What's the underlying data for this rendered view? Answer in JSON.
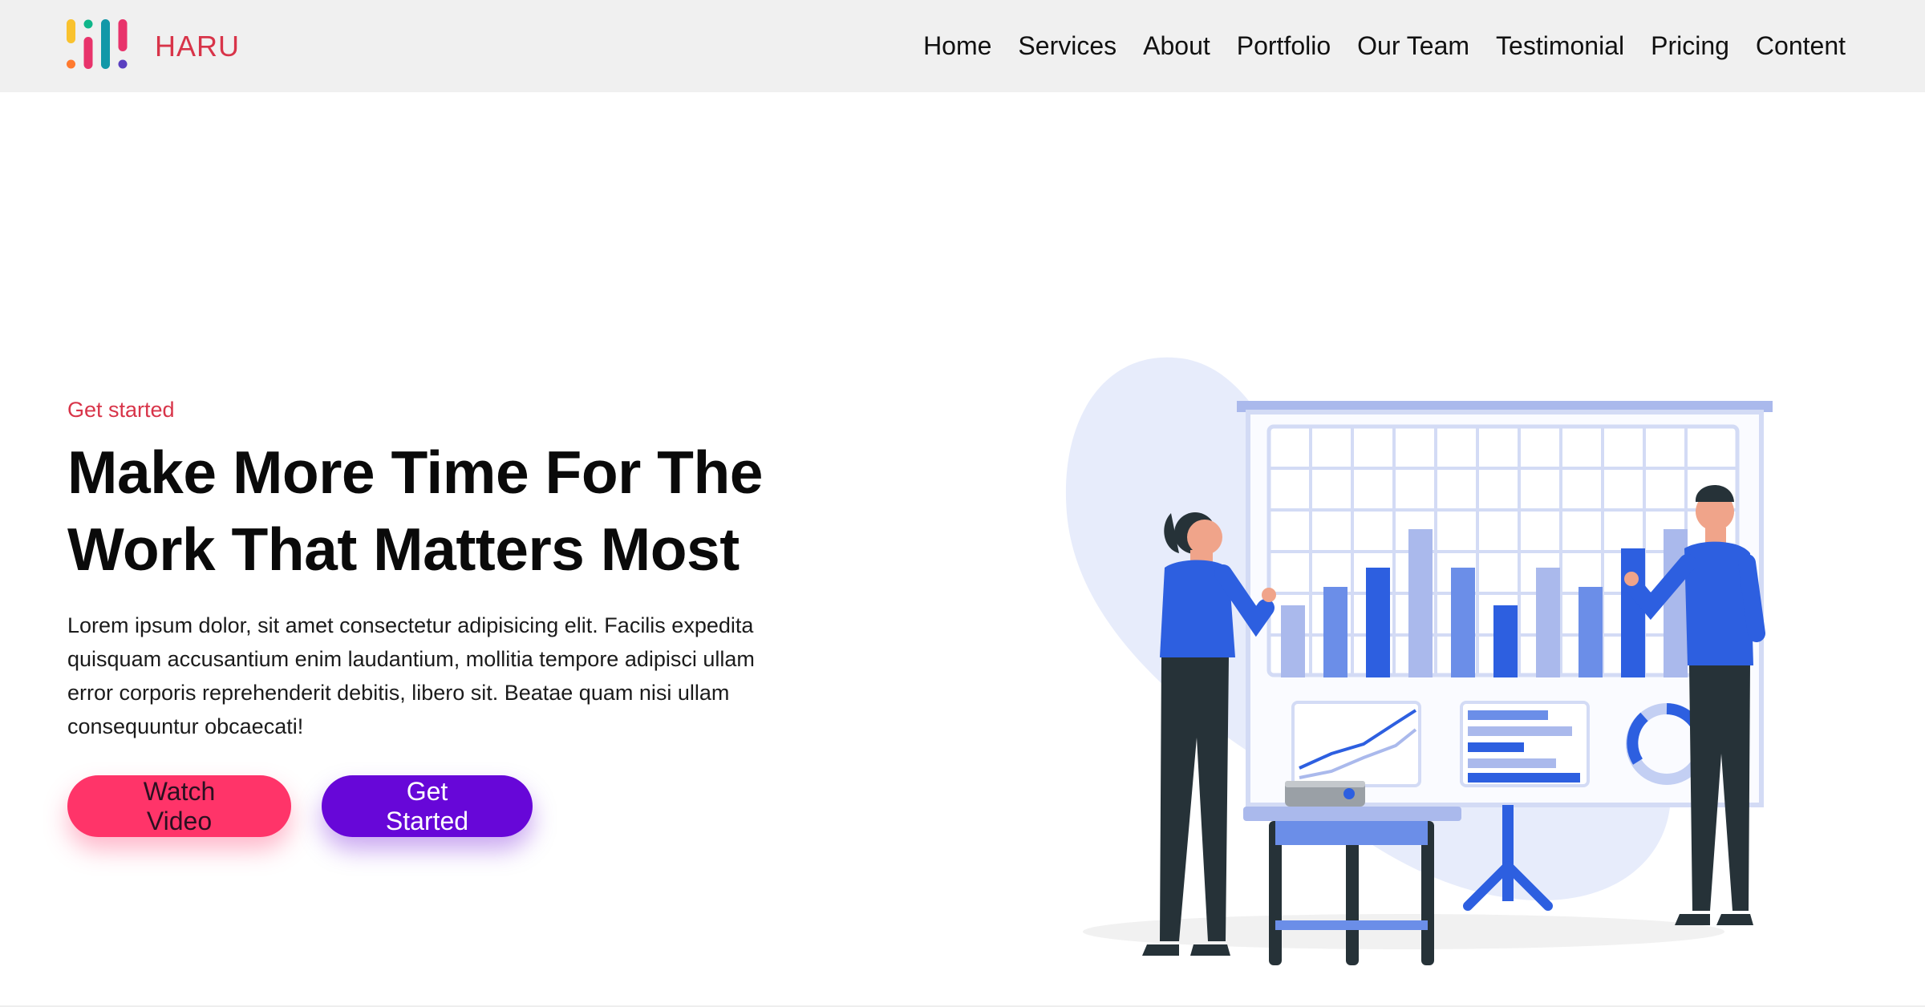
{
  "brand": {
    "name": "HARU"
  },
  "nav": {
    "items": [
      "Home",
      "Services",
      "About",
      "Portfolio",
      "Our Team",
      "Testimonial",
      "Pricing",
      "Content"
    ]
  },
  "hero": {
    "kicker": "Get started",
    "headline_line1": "Make More Time For The",
    "headline_line2": "Work That Matters Most",
    "lead": "Lorem ipsum dolor, sit amet consectetur adipisicing elit. Facilis expedita quisquam accusantium enim laudantium, mollitia tempore adipisci ullam error corporis reprehenderit debitis, libero sit. Beatae quam nisi ullam consequuntur obcaecati!",
    "watch_label": "Watch Video",
    "start_label": "Get Started"
  },
  "colors": {
    "accent_red": "#d83449",
    "button_pink": "#ff3469",
    "button_purple": "#6707d8",
    "illustration_blue": "#2d5fe0"
  },
  "icons": {
    "logo": "haru-logo-bars-icon"
  }
}
